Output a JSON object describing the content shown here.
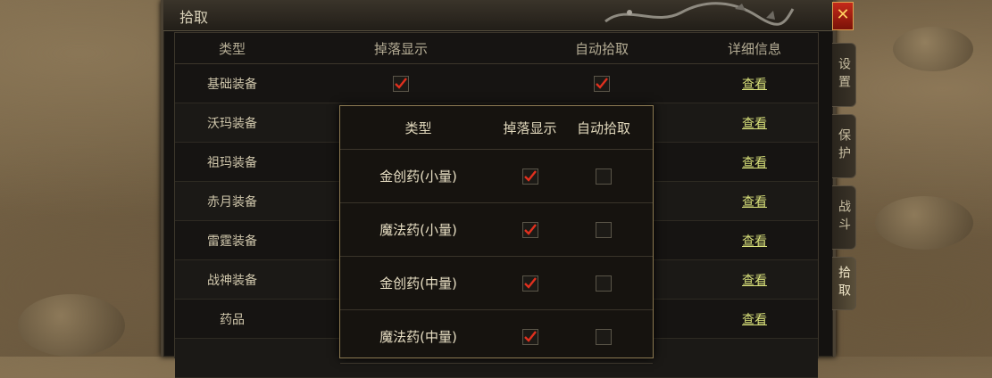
{
  "window": {
    "title": "拾取",
    "close_label": "✕"
  },
  "side_tabs": [
    {
      "label": "设置",
      "active": false
    },
    {
      "label": "保护",
      "active": false
    },
    {
      "label": "战斗",
      "active": false
    },
    {
      "label": "拾取",
      "active": true
    }
  ],
  "table": {
    "headers": [
      "类型",
      "掉落显示",
      "自动拾取",
      "详细信息"
    ],
    "rows": [
      {
        "type": "基础装备",
        "drop_display": true,
        "auto_pickup": true,
        "detail": "查看"
      },
      {
        "type": "沃玛装备",
        "drop_display": null,
        "auto_pickup": null,
        "detail": "查看"
      },
      {
        "type": "祖玛装备",
        "drop_display": null,
        "auto_pickup": null,
        "detail": "查看"
      },
      {
        "type": "赤月装备",
        "drop_display": null,
        "auto_pickup": null,
        "detail": "查看"
      },
      {
        "type": "雷霆装备",
        "drop_display": null,
        "auto_pickup": null,
        "detail": "查看"
      },
      {
        "type": "战神装备",
        "drop_display": null,
        "auto_pickup": null,
        "detail": "查看"
      },
      {
        "type": "药品",
        "drop_display": null,
        "auto_pickup": null,
        "detail": "查看"
      },
      {
        "type": "",
        "drop_display": null,
        "auto_pickup": null,
        "detail": ""
      }
    ]
  },
  "popup": {
    "headers": [
      "类型",
      "掉落显示",
      "自动拾取"
    ],
    "rows": [
      {
        "type": "金创药(小量)",
        "drop_display": true,
        "auto_pickup": false
      },
      {
        "type": "魔法药(小量)",
        "drop_display": true,
        "auto_pickup": false
      },
      {
        "type": "金创药(中量)",
        "drop_display": true,
        "auto_pickup": false
      },
      {
        "type": "魔法药(中量)",
        "drop_display": true,
        "auto_pickup": false
      }
    ]
  },
  "colors": {
    "check_red": "#e0301e",
    "link": "#d8e07a",
    "accent_gold": "#8c7a52"
  }
}
